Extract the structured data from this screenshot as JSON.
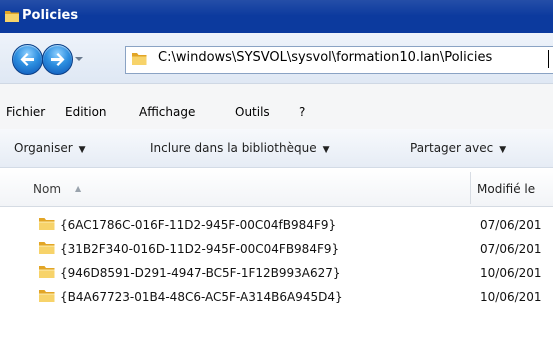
{
  "window": {
    "title": "Policies",
    "address": "C:\\windows\\SYSVOL\\sysvol\\formation10.lan\\Policies"
  },
  "menu": [
    "Fichier",
    "Edition",
    "Affichage",
    "Outils",
    "?"
  ],
  "toolbar": {
    "organize": "Organiser",
    "include": "Inclure dans la bibliothèque",
    "share": "Partager avec"
  },
  "columns": {
    "name": "Nom",
    "modified": "Modifié le"
  },
  "files": [
    {
      "name": "{6AC1786C-016F-11D2-945F-00C04fB984F9}",
      "modified": "07/06/201"
    },
    {
      "name": "{31B2F340-016D-11D2-945F-00C04FB984F9}",
      "modified": "07/06/201"
    },
    {
      "name": "{946D8591-D291-4947-BC5F-1F12B993A627}",
      "modified": "10/06/201"
    },
    {
      "name": "{B4A67723-01B4-48C6-AC5F-A314B6A945D4}",
      "modified": "10/06/201"
    }
  ],
  "colors": {
    "titlebar": "#0c3a9e",
    "folder": "#f2c44a"
  }
}
